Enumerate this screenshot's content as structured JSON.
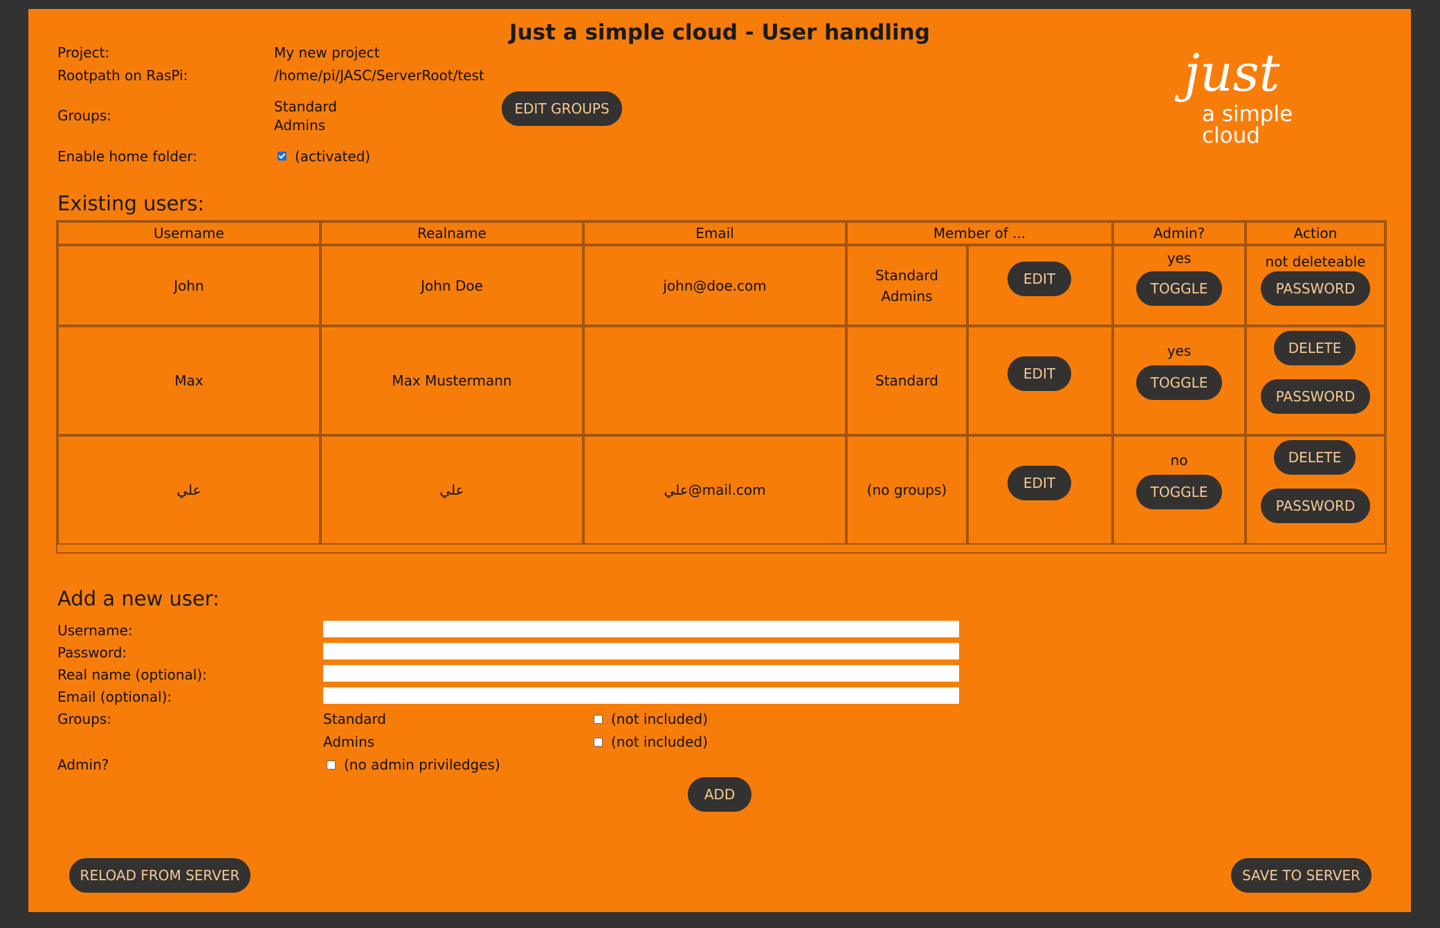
{
  "title": "Just a simple cloud - User handling",
  "project": {
    "project_label": "Project:",
    "project_value": "My new project",
    "rootpath_label": "Rootpath on RasPi:",
    "rootpath_value": "/home/pi/JASC/ServerRoot/test",
    "groups_label": "Groups:",
    "groups": [
      "Standard",
      "Admins"
    ],
    "edit_groups_label": "EDIT GROUPS",
    "home_folder_label": "Enable home folder:",
    "home_folder_checked": true,
    "home_folder_status": "(activated)"
  },
  "logo": {
    "word": "just",
    "sub": "a simple cloud"
  },
  "existing_users": {
    "heading": "Existing users:",
    "columns": [
      "Username",
      "Realname",
      "Email",
      "Member of ...",
      "Admin?",
      "Action"
    ],
    "rows": [
      {
        "username": "John",
        "realname": "John Doe",
        "email": "john@doe.com",
        "groups": [
          "Standard",
          "Admins"
        ],
        "edit_label": "EDIT",
        "admin": "yes",
        "toggle_label": "TOGGLE",
        "action_note": "not deleteable",
        "delete_label": "",
        "password_label": "PASSWORD"
      },
      {
        "username": "Max",
        "realname": "Max Mustermann",
        "email": "",
        "groups": [
          "Standard"
        ],
        "edit_label": "EDIT",
        "admin": "yes",
        "toggle_label": "TOGGLE",
        "action_note": "",
        "delete_label": "DELETE",
        "password_label": "PASSWORD"
      },
      {
        "username": "علي",
        "realname": "علي",
        "email": "علي@mail.com",
        "groups": [
          "(no groups)"
        ],
        "edit_label": "EDIT",
        "admin": "no",
        "toggle_label": "TOGGLE",
        "action_note": "",
        "delete_label": "DELETE",
        "password_label": "PASSWORD"
      }
    ]
  },
  "add_user": {
    "heading": "Add a new user:",
    "username_label": "Username:",
    "password_label": "Password:",
    "realname_label": "Real name (optional):",
    "email_label": "Email (optional):",
    "groups_label": "Groups:",
    "group_options": [
      {
        "name": "Standard",
        "status": "(not included)"
      },
      {
        "name": "Admins",
        "status": "(not included)"
      }
    ],
    "admin_label": "Admin?",
    "admin_status": "(no admin priviledges)",
    "add_label": "ADD"
  },
  "footer": {
    "reload_label": "RELOAD FROM SERVER",
    "save_label": "SAVE TO SERVER"
  },
  "colors": {
    "background": "#323232",
    "panel": "#f77d0a",
    "button": "#333231",
    "button_text": "#f6c995"
  }
}
